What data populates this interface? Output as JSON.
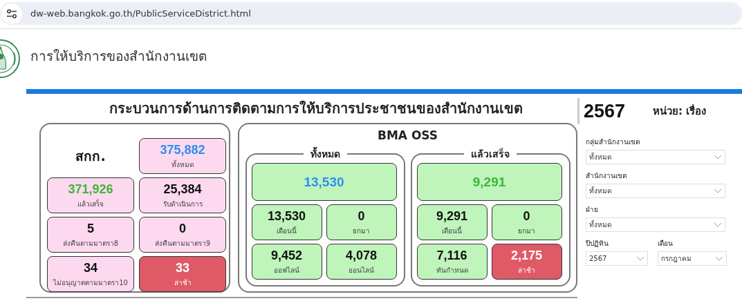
{
  "browser": {
    "url": "dw-web.bangkok.go.th/PublicServiceDistrict.html"
  },
  "header": {
    "title": "การให้บริการของสำนักงานเขต"
  },
  "dashboard": {
    "title": "กระบวนการด้านการติดตามการให้บริการประชาชนของสำนักงานเขต",
    "year": "2567",
    "unit": "หน่วย: เรื่อง"
  },
  "sakk": {
    "title": "สกก.",
    "tiles": [
      {
        "value": "375,882",
        "label": "ทั้งหมด",
        "kind": "total"
      },
      {
        "value": "371,926",
        "label": "แล้วเสร็จ",
        "kind": "done"
      },
      {
        "value": "25,384",
        "label": "รับดำเนินการ",
        "kind": "plain"
      },
      {
        "value": "5",
        "label": "ส่งคืนตามมาตรา8",
        "kind": "plain"
      },
      {
        "value": "0",
        "label": "ส่งคืนตามมาตรา9",
        "kind": "plain"
      },
      {
        "value": "34",
        "label": "ไม่อนุญาตตามมาตรา10",
        "kind": "plain"
      },
      {
        "value": "33",
        "label": "ล่าช้า",
        "kind": "late"
      }
    ]
  },
  "oss": {
    "title": "BMA OSS",
    "groups": [
      {
        "title": "ทั้งหมด",
        "main": {
          "value": "13,530",
          "kind": "total"
        },
        "tiles": [
          {
            "value": "13,530",
            "label": "เดือนนี้",
            "kind": "plain"
          },
          {
            "value": "0",
            "label": "ยกมา",
            "kind": "plain"
          },
          {
            "value": "9,452",
            "label": "ออฟไลน์",
            "kind": "plain"
          },
          {
            "value": "4,078",
            "label": "ออนไลน์",
            "kind": "plain"
          }
        ]
      },
      {
        "title": "แล้วเสร็จ",
        "main": {
          "value": "9,291",
          "kind": "done"
        },
        "tiles": [
          {
            "value": "9,291",
            "label": "เดือนนี้",
            "kind": "plain"
          },
          {
            "value": "0",
            "label": "ยกมา",
            "kind": "plain"
          },
          {
            "value": "7,116",
            "label": "ทันกำหนด",
            "kind": "plain"
          },
          {
            "value": "2,175",
            "label": "ล่าช้า",
            "kind": "late"
          }
        ]
      }
    ]
  },
  "filters": [
    {
      "label": "กลุ่มสำนักงานเขต",
      "value": "ทั้งหมด",
      "kind": "wide"
    },
    {
      "label": "สำนักงานเขต",
      "value": "ทั้งหมด",
      "kind": "wide"
    },
    {
      "label": "ฝ่าย",
      "value": "ทั้งหมด",
      "kind": "wide"
    },
    {
      "label": "ปีปฏิทิน",
      "value": "2567",
      "kind": "half"
    },
    {
      "label": "เดือน",
      "value": "กรกฎาคม",
      "kind": "half"
    }
  ]
}
